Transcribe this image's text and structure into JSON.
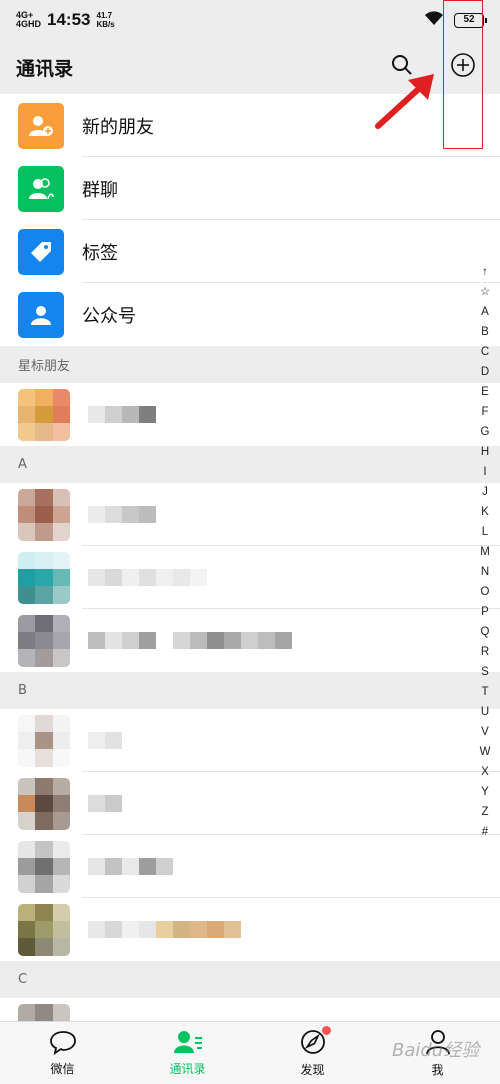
{
  "status_bar": {
    "network_1": "4G+",
    "network_2": "4GHD",
    "time": "14:53",
    "speed_value": "41.7",
    "speed_unit": "KB/s",
    "battery": "52"
  },
  "nav": {
    "title": "通讯录",
    "search_icon": "search-icon",
    "add_icon": "plus-circle-icon"
  },
  "features": [
    {
      "label": "新的朋友",
      "icon": "add-friend-icon",
      "color": "#fa9d3b"
    },
    {
      "label": "群聊",
      "icon": "group-icon",
      "color": "#07c160"
    },
    {
      "label": "标签",
      "icon": "tag-icon",
      "color": "#1485ee"
    },
    {
      "label": "公众号",
      "icon": "official-account-icon",
      "color": "#1485ee"
    }
  ],
  "sections": [
    {
      "header": "星标朋友"
    },
    {
      "header": "A"
    },
    {
      "header": "B"
    },
    {
      "header": "C"
    }
  ],
  "index_letters": [
    "↑",
    "☆",
    "A",
    "B",
    "C",
    "D",
    "E",
    "F",
    "G",
    "H",
    "I",
    "J",
    "K",
    "L",
    "M",
    "N",
    "O",
    "P",
    "Q",
    "R",
    "S",
    "T",
    "U",
    "V",
    "W",
    "X",
    "Y",
    "Z",
    "#"
  ],
  "tabs": [
    {
      "label": "微信",
      "icon": "chat-icon"
    },
    {
      "label": "通讯录",
      "icon": "contacts-icon"
    },
    {
      "label": "发现",
      "icon": "compass-icon"
    },
    {
      "label": "我",
      "icon": "person-icon"
    }
  ],
  "colors": {
    "accent": "#07c160",
    "annotation": "#e02020",
    "badge": "#fa5151"
  },
  "watermark": "Baidu经验"
}
